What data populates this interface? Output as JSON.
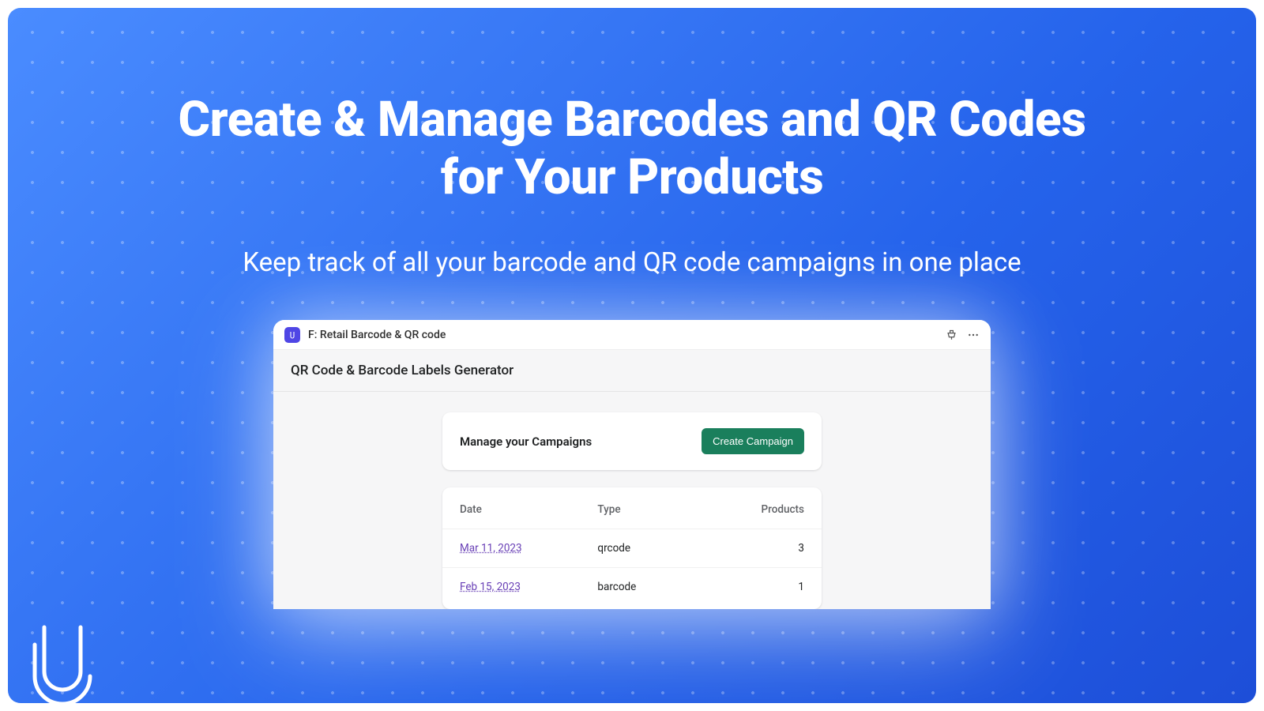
{
  "hero": {
    "title": "Create & Manage Barcodes and QR Codes for Your Products",
    "subtitle": "Keep track of all your barcode and QR code campaigns in one place"
  },
  "window": {
    "title": "F: Retail Barcode & QR code",
    "subtitle": "QR Code & Barcode Labels Generator"
  },
  "panel": {
    "heading": "Manage your Campaigns",
    "create_label": "Create Campaign"
  },
  "table": {
    "columns": {
      "date": "Date",
      "type": "Type",
      "products": "Products"
    },
    "rows": [
      {
        "date": "Mar 11, 2023",
        "type": "qrcode",
        "products": "3"
      },
      {
        "date": "Feb 15, 2023",
        "type": "barcode",
        "products": "1"
      }
    ]
  }
}
